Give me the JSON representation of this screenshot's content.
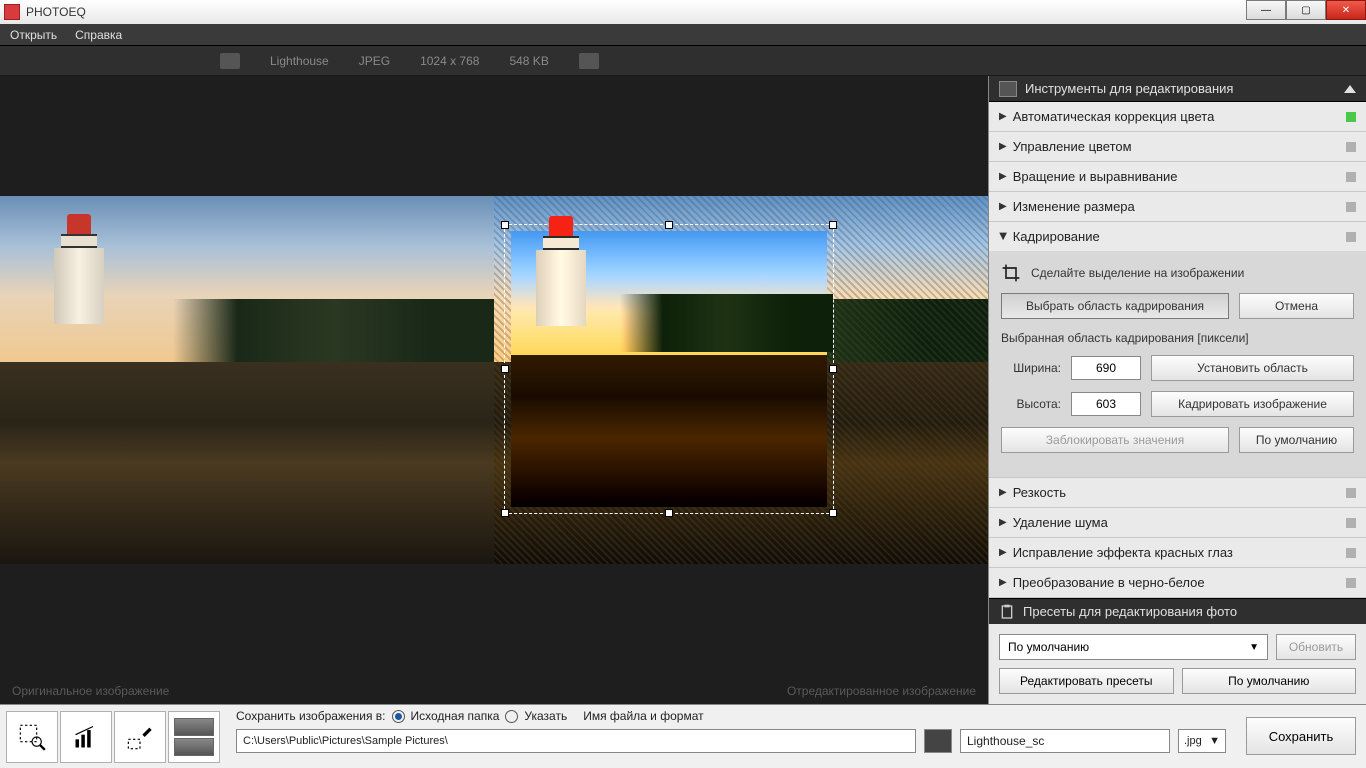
{
  "title": "PHOTOEQ",
  "menu": {
    "open": "Открыть",
    "help": "Справка"
  },
  "info": {
    "name": "Lighthouse",
    "format": "JPEG",
    "dims": "1024 x 768",
    "size": "548 KB"
  },
  "canvas": {
    "orig": "Оригинальное изображение",
    "edited": "Отредактированное изображение"
  },
  "panel": {
    "tools_title": "Инструменты для редактирования",
    "items": {
      "auto_color": "Автоматическая коррекция цвета",
      "color_mgmt": "Управление цветом",
      "rotate": "Вращение и выравнивание",
      "resize": "Изменение размера",
      "crop": "Кадрирование",
      "sharp": "Резкость",
      "denoise": "Удаление шума",
      "redeye": "Исправление эффекта красных глаз",
      "bw": "Преобразование в черно-белое"
    },
    "crop": {
      "hint": "Сделайте выделение на изображении",
      "select_btn": "Выбрать область кадрирования",
      "cancel": "Отмена",
      "area_label": "Выбранная область кадрирования [пиксели]",
      "width_lbl": "Ширина:",
      "width_val": "690",
      "height_lbl": "Высота:",
      "height_val": "603",
      "set_area": "Установить область",
      "do_crop": "Кадрировать изображение",
      "lock": "Заблокировать значения",
      "defaults": "По умолчанию"
    },
    "presets_title": "Пресеты для редактирования фото",
    "presets": {
      "selected": "По умолчанию",
      "refresh": "Обновить",
      "edit": "Редактировать пресеты",
      "defaults": "По умолчанию"
    }
  },
  "bottom": {
    "save_to": "Сохранить изображения в:",
    "src_folder": "Исходная папка",
    "specify": "Указать",
    "name_fmt": "Имя файла и формат",
    "path": "C:\\Users\\Public\\Pictures\\Sample Pictures\\",
    "filename": "Lighthouse_sc",
    "ext": ".jpg",
    "save": "Сохранить"
  }
}
